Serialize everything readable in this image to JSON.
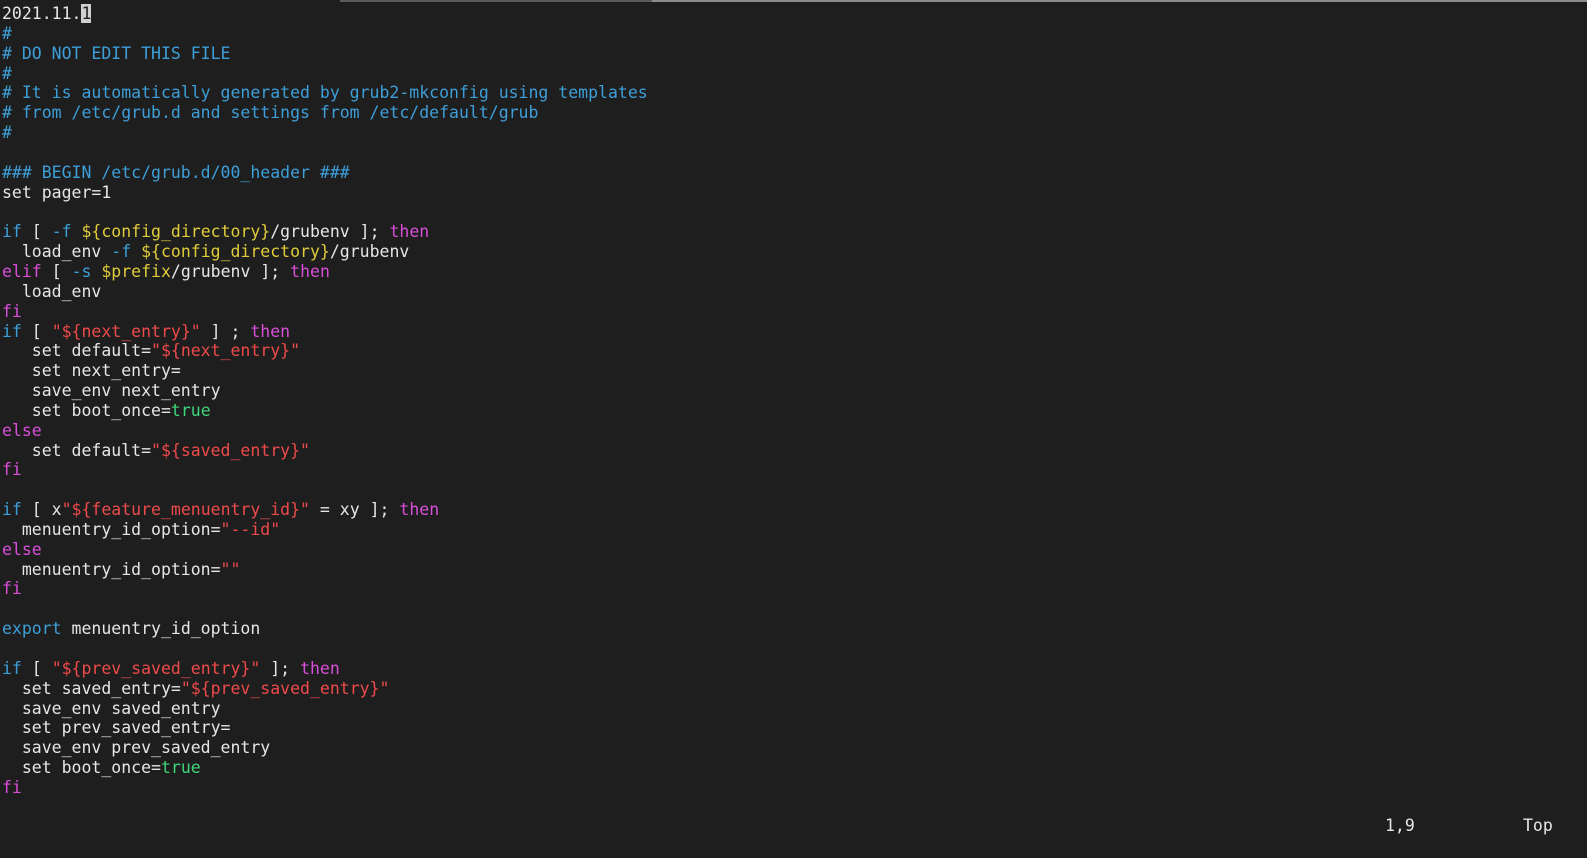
{
  "colors": {
    "background": "#1e1e1e",
    "text": "#e6e6e6",
    "comment": "#3d9fd9",
    "keyword": "#3d9fd9",
    "flow": "#d94ed9",
    "variable": "#e0cc3a",
    "string": "#ee4a4a",
    "boolean": "#3ed67a"
  },
  "editor": {
    "lines": [
      [
        {
          "t": "2021.11.",
          "c": "plain"
        },
        {
          "t": "1",
          "c": "cursor"
        }
      ],
      [
        {
          "t": "#",
          "c": "comment"
        }
      ],
      [
        {
          "t": "# DO NOT EDIT THIS FILE",
          "c": "comment"
        }
      ],
      [
        {
          "t": "#",
          "c": "comment"
        }
      ],
      [
        {
          "t": "# It is automatically generated by grub2-mkconfig using templates",
          "c": "comment"
        }
      ],
      [
        {
          "t": "# from /etc/grub.d and settings from /etc/default/grub",
          "c": "comment"
        }
      ],
      [
        {
          "t": "#",
          "c": "comment"
        }
      ],
      [],
      [
        {
          "t": "### BEGIN /etc/grub.d/00_header ###",
          "c": "comment"
        }
      ],
      [
        {
          "t": "set pager=1",
          "c": "plain"
        }
      ],
      [],
      [
        {
          "t": "if",
          "c": "kw"
        },
        {
          "t": " [ ",
          "c": "plain"
        },
        {
          "t": "-f",
          "c": "kw"
        },
        {
          "t": " ",
          "c": "plain"
        },
        {
          "t": "${config_directory}",
          "c": "var"
        },
        {
          "t": "/grubenv ]; ",
          "c": "plain"
        },
        {
          "t": "then",
          "c": "flow"
        }
      ],
      [
        {
          "t": "  load_env ",
          "c": "plain"
        },
        {
          "t": "-f",
          "c": "kw"
        },
        {
          "t": " ",
          "c": "plain"
        },
        {
          "t": "${config_directory}",
          "c": "var"
        },
        {
          "t": "/grubenv",
          "c": "plain"
        }
      ],
      [
        {
          "t": "elif",
          "c": "flow"
        },
        {
          "t": " [ ",
          "c": "plain"
        },
        {
          "t": "-s",
          "c": "kw"
        },
        {
          "t": " ",
          "c": "plain"
        },
        {
          "t": "$prefix",
          "c": "var"
        },
        {
          "t": "/grubenv ]; ",
          "c": "plain"
        },
        {
          "t": "then",
          "c": "flow"
        }
      ],
      [
        {
          "t": "  load_env",
          "c": "plain"
        }
      ],
      [
        {
          "t": "fi",
          "c": "flow"
        }
      ],
      [
        {
          "t": "if",
          "c": "kw"
        },
        {
          "t": " [ ",
          "c": "plain"
        },
        {
          "t": "\"${next_entry}\"",
          "c": "str"
        },
        {
          "t": " ] ; ",
          "c": "plain"
        },
        {
          "t": "then",
          "c": "flow"
        }
      ],
      [
        {
          "t": "   set default=",
          "c": "plain"
        },
        {
          "t": "\"${next_entry}\"",
          "c": "str"
        }
      ],
      [
        {
          "t": "   set next_entry=",
          "c": "plain"
        }
      ],
      [
        {
          "t": "   save_env next_entry",
          "c": "plain"
        }
      ],
      [
        {
          "t": "   set boot_once=",
          "c": "plain"
        },
        {
          "t": "true",
          "c": "bool"
        }
      ],
      [
        {
          "t": "else",
          "c": "flow"
        }
      ],
      [
        {
          "t": "   set default=",
          "c": "plain"
        },
        {
          "t": "\"${saved_entry}\"",
          "c": "str"
        }
      ],
      [
        {
          "t": "fi",
          "c": "flow"
        }
      ],
      [],
      [
        {
          "t": "if",
          "c": "kw"
        },
        {
          "t": " [ x",
          "c": "plain"
        },
        {
          "t": "\"${feature_menuentry_id}\"",
          "c": "str"
        },
        {
          "t": " = xy ]; ",
          "c": "plain"
        },
        {
          "t": "then",
          "c": "flow"
        }
      ],
      [
        {
          "t": "  menuentry_id_option=",
          "c": "plain"
        },
        {
          "t": "\"--id\"",
          "c": "str"
        }
      ],
      [
        {
          "t": "else",
          "c": "flow"
        }
      ],
      [
        {
          "t": "  menuentry_id_option=",
          "c": "plain"
        },
        {
          "t": "\"\"",
          "c": "str"
        }
      ],
      [
        {
          "t": "fi",
          "c": "flow"
        }
      ],
      [],
      [
        {
          "t": "export",
          "c": "kw"
        },
        {
          "t": " menuentry_id_option",
          "c": "plain"
        }
      ],
      [],
      [
        {
          "t": "if",
          "c": "kw"
        },
        {
          "t": " [ ",
          "c": "plain"
        },
        {
          "t": "\"${prev_saved_entry}\"",
          "c": "str"
        },
        {
          "t": " ]; ",
          "c": "plain"
        },
        {
          "t": "then",
          "c": "flow"
        }
      ],
      [
        {
          "t": "  set saved_entry=",
          "c": "plain"
        },
        {
          "t": "\"${prev_saved_entry}\"",
          "c": "str"
        }
      ],
      [
        {
          "t": "  save_env saved_entry",
          "c": "plain"
        }
      ],
      [
        {
          "t": "  set prev_saved_entry=",
          "c": "plain"
        }
      ],
      [
        {
          "t": "  save_env prev_saved_entry",
          "c": "plain"
        }
      ],
      [
        {
          "t": "  set boot_once=",
          "c": "plain"
        },
        {
          "t": "true",
          "c": "bool"
        }
      ],
      [
        {
          "t": "fi",
          "c": "flow"
        }
      ]
    ]
  },
  "status": {
    "cursor_position": "1,9",
    "scroll_position": "Top"
  }
}
